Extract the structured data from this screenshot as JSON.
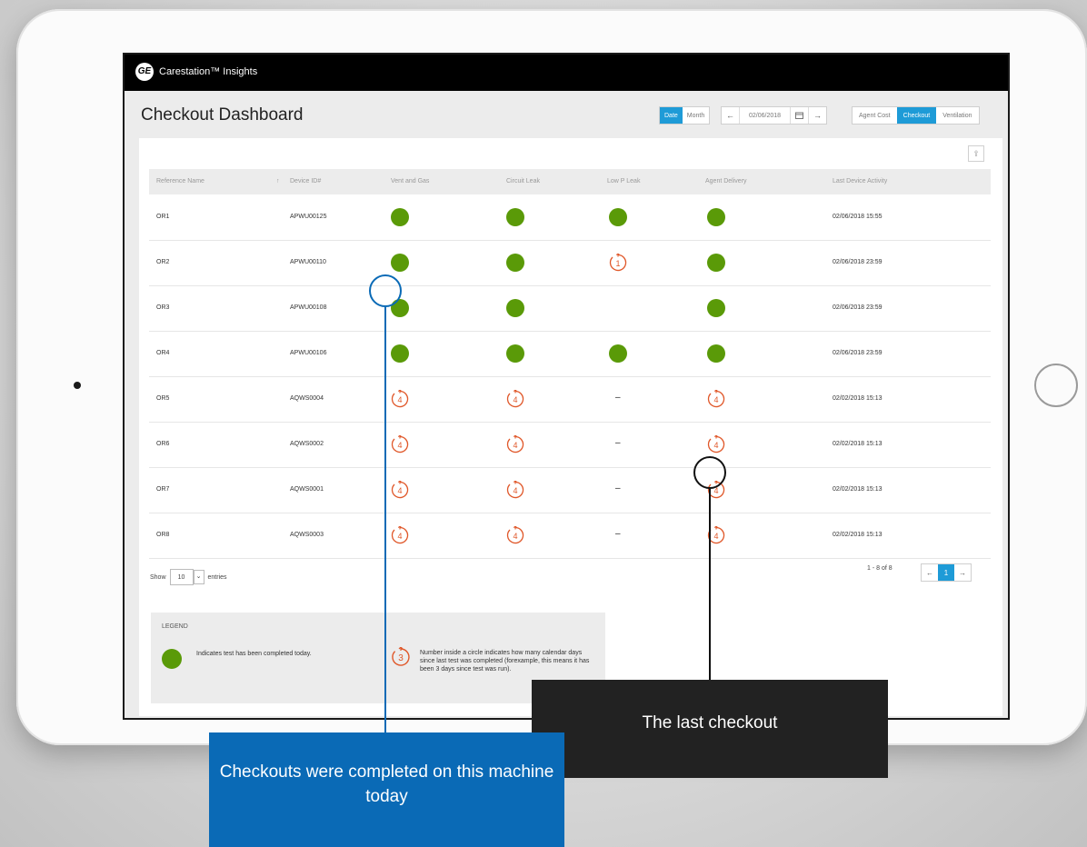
{
  "app": {
    "logo_text": "GE",
    "title": "Carestation™ Insights"
  },
  "page": {
    "title": "Checkout Dashboard"
  },
  "controls": {
    "date_label": "Date",
    "month_label": "Month",
    "prev_arrow": "←",
    "current_date": "02/06/2018",
    "next_arrow": "→",
    "tabs": [
      "Agent Cost",
      "Checkout",
      "Ventilation"
    ],
    "active_tab": "Checkout"
  },
  "table": {
    "columns": [
      "Reference Name",
      "Device ID#",
      "Vent and Gas",
      "Circuit Leak",
      "Low P Leak",
      "Agent Delivery",
      "Last Device Activity"
    ],
    "sort_arrow": "↑",
    "rows": [
      {
        "ref": "OR1",
        "device": "APWU00125",
        "vent": "done",
        "circuit": "done",
        "lowp": "done",
        "agent": "done",
        "activity": "02/06/2018 15:55"
      },
      {
        "ref": "OR2",
        "device": "APWU00110",
        "vent": "done",
        "circuit": "done",
        "lowp": "1",
        "agent": "done",
        "activity": "02/06/2018 23:59"
      },
      {
        "ref": "OR3",
        "device": "APWU00108",
        "vent": "done",
        "circuit": "done",
        "lowp": "",
        "agent": "done",
        "activity": "02/06/2018 23:59"
      },
      {
        "ref": "OR4",
        "device": "APWU00106",
        "vent": "done",
        "circuit": "done",
        "lowp": "done",
        "agent": "done",
        "activity": "02/06/2018 23:59"
      },
      {
        "ref": "OR5",
        "device": "AQWS0004",
        "vent": "4",
        "circuit": "4",
        "lowp": "–",
        "agent": "4",
        "activity": "02/02/2018 15:13"
      },
      {
        "ref": "OR6",
        "device": "AQWS0002",
        "vent": "4",
        "circuit": "4",
        "lowp": "–",
        "agent": "4",
        "activity": "02/02/2018 15:13"
      },
      {
        "ref": "OR7",
        "device": "AQWS0001",
        "vent": "4",
        "circuit": "4",
        "lowp": "–",
        "agent": "4",
        "activity": "02/02/2018 15:13"
      },
      {
        "ref": "OR8",
        "device": "AQWS0003",
        "vent": "4",
        "circuit": "4",
        "lowp": "–",
        "agent": "4",
        "activity": "02/02/2018 15:13"
      }
    ]
  },
  "entries": {
    "show_label": "Show",
    "value": "10",
    "suffix": "entries"
  },
  "pagination": {
    "info": "1 - 8 of 8",
    "prev": "←",
    "page": "1",
    "next": "→"
  },
  "legend": {
    "heading": "LEGEND",
    "done_text": "Indicates test has been completed today.",
    "days_example": "3",
    "days_text": "Number inside a circle indicates how many calendar days since last test was completed (forexample, this means it has been 3 days since test was run)."
  },
  "callouts": {
    "today": "Checkouts were completed on this machine today",
    "last": "The last checkout"
  },
  "colors": {
    "accent": "#1e9bd7",
    "done": "#5a9a08",
    "overdue": "#e0582a",
    "callout_blue": "#0a6ab6",
    "callout_dark": "#222222"
  }
}
